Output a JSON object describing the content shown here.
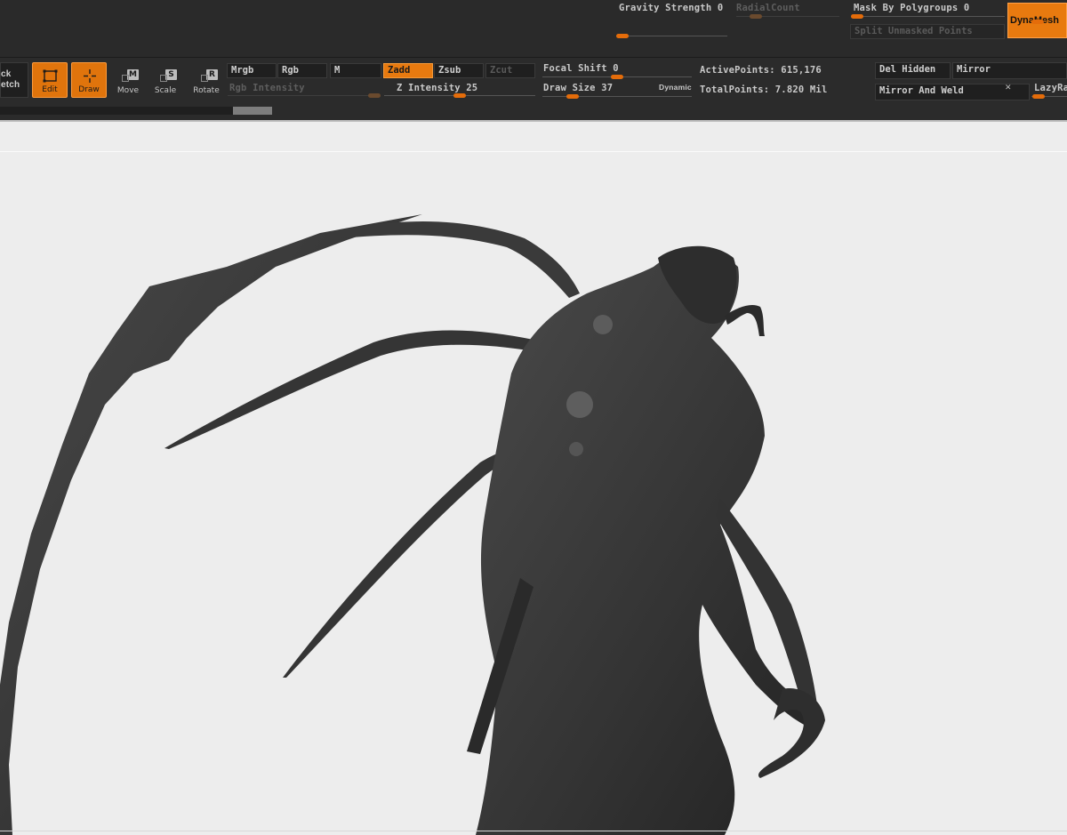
{
  "colors": {
    "accent": "#e87a0f",
    "toolbar_bg": "#2b2b2b",
    "canvas_bg": "#ededed",
    "model": "#3d3d3d"
  },
  "top_row": {
    "gravity_strength": "Gravity Strength 0",
    "radial_count": "RadialCount",
    "mask_by_polygroups": "Mask By Polygroups 0",
    "split_unmasked_points": "Split Unmasked Points",
    "dynamesh": "DynaMesh"
  },
  "tools": {
    "lightbox_partial_line1": "ck",
    "lightbox_partial_line2": "etch",
    "edit": {
      "label": "Edit",
      "icon": "edit-icon"
    },
    "draw": {
      "label": "Draw",
      "icon": "draw-icon"
    },
    "move": {
      "label": "Move",
      "key": "M"
    },
    "scale": {
      "label": "Scale",
      "key": "S"
    },
    "rotate": {
      "label": "Rotate",
      "key": "R"
    }
  },
  "color_modes": {
    "mrgb": "Mrgb",
    "rgb": "Rgb",
    "m": "M",
    "rgb_intensity": "Rgb Intensity"
  },
  "depth_modes": {
    "zadd": "Zadd",
    "zsub": "Zsub",
    "zcut": "Zcut",
    "z_intensity": "Z Intensity 25",
    "z_intensity_value": 25
  },
  "brush": {
    "focal_shift": "Focal Shift 0",
    "draw_size": "Draw Size 37",
    "dynamic": "Dynamic"
  },
  "stats": {
    "active_points": "ActivePoints: 615,176",
    "total_points": "TotalPoints: 7.820 Mil"
  },
  "right_panel": {
    "del_hidden": "Del Hidden",
    "mirror": "Mirror",
    "mirror_and_weld": "Mirror And Weld",
    "lazy_partial": "LazyRa"
  },
  "canvas": {
    "subject": "dark-creature-sculpt"
  }
}
